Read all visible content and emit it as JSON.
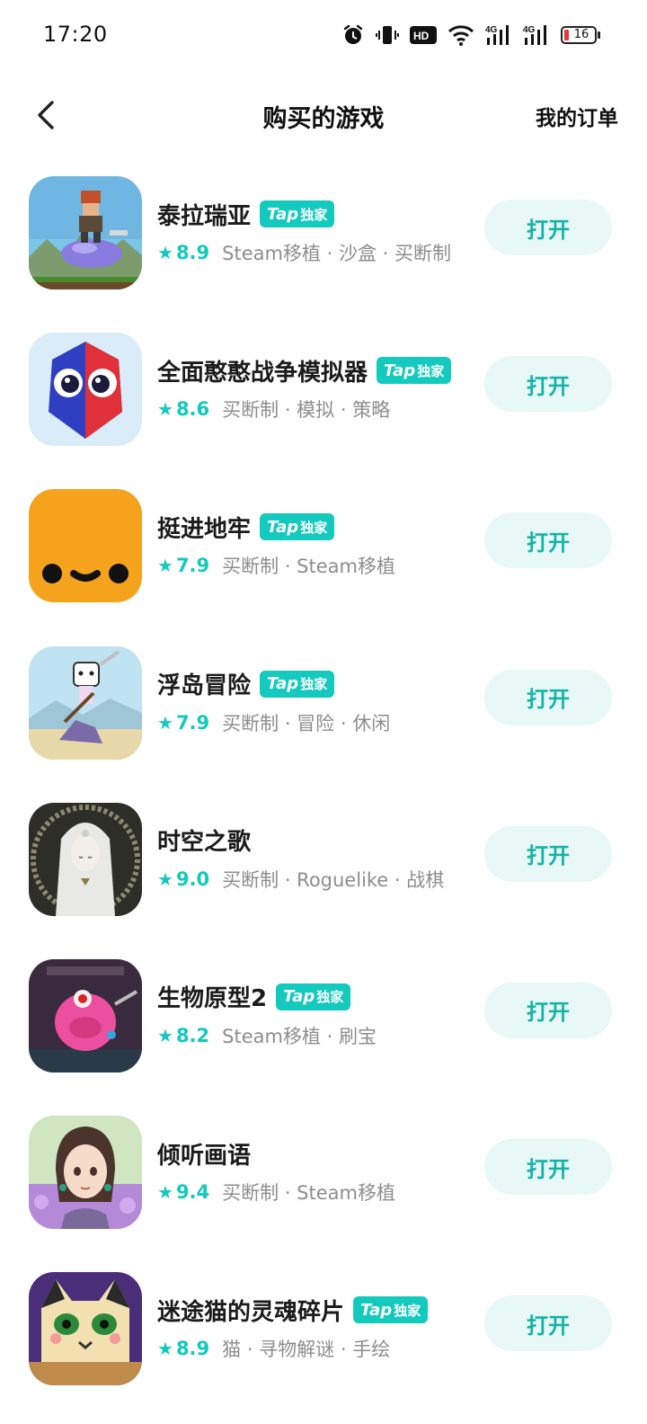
{
  "status_bar": {
    "time": "17:20",
    "battery": "16",
    "icons": [
      "alarm-icon",
      "vibrate-icon",
      "hd-icon",
      "wifi-icon",
      "signal-4g-icon",
      "signal-4g-icon",
      "battery-icon"
    ],
    "hd_label": "HD",
    "net_label": "4G"
  },
  "header": {
    "title": "购买的游戏",
    "orders_label": "我的订单",
    "back_icon": "chevron-left-icon"
  },
  "badge": {
    "tap": "Tap",
    "exclusive": "独家"
  },
  "accent_color": "#14c9bd",
  "games": [
    {
      "name": "泰拉瑞亚",
      "exclusive": true,
      "rating": "8.9",
      "tags": "Steam移植 · 沙盒 · 买断制",
      "button": "打开"
    },
    {
      "name": "全面憨憨战争模拟器",
      "exclusive": true,
      "rating": "8.6",
      "tags": "买断制 · 模拟 · 策略",
      "button": "打开"
    },
    {
      "name": "挺进地牢",
      "exclusive": true,
      "rating": "7.9",
      "tags": "买断制 · Steam移植",
      "button": "打开"
    },
    {
      "name": "浮岛冒险",
      "exclusive": true,
      "rating": "7.9",
      "tags": "买断制 · 冒险 · 休闲",
      "button": "打开"
    },
    {
      "name": "时空之歌",
      "exclusive": false,
      "rating": "9.0",
      "tags": "买断制 · Roguelike · 战棋",
      "button": "打开"
    },
    {
      "name": "生物原型2",
      "exclusive": true,
      "rating": "8.2",
      "tags": "Steam移植 · 刷宝",
      "button": "打开"
    },
    {
      "name": "倾听画语",
      "exclusive": false,
      "rating": "9.4",
      "tags": "买断制 · Steam移植",
      "button": "打开"
    },
    {
      "name": "迷途猫的灵魂碎片",
      "exclusive": true,
      "rating": "8.9",
      "tags": "猫 · 寻物解谜 · 手绘",
      "button": "打开"
    }
  ]
}
